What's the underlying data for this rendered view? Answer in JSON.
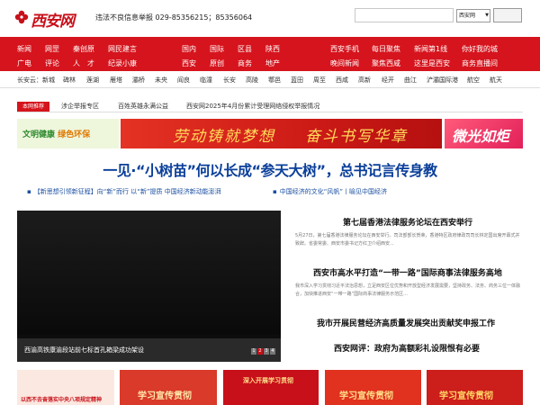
{
  "header": {
    "logo_text": "西安网",
    "report_text": "违法不良信息举报 029-85356215；85356064",
    "site_select": "西安网",
    "search_placeholder": ""
  },
  "nav": {
    "groups": [
      {
        "row1": [
          "新闻",
          "网罡",
          "秦创原",
          "网民建言"
        ],
        "row2": [
          "广电",
          "评论",
          "人　才",
          "纪录小康"
        ]
      },
      {
        "row1": [
          "国内",
          "国际",
          "区县",
          "陕西"
        ],
        "row2": [
          "西安",
          "原创",
          "商务",
          "地产"
        ]
      },
      {
        "row1": [
          "西安手机",
          "每日聚焦",
          "新闻第1线",
          "你好我的城"
        ],
        "row2": [
          "晚间新闻",
          "聚焦西咸",
          "这里是西安",
          "商务直播间"
        ]
      }
    ]
  },
  "subnav": {
    "items": [
      "长安云：新城",
      "碑林",
      "莲湖",
      "雁塔",
      "灞桥",
      "未央",
      "阎良",
      "临潼",
      "长安",
      "高陵",
      "鄠邑",
      "蓝田",
      "周至",
      "西咸",
      "高新",
      "经开",
      "曲江",
      "浐灞国际港",
      "航空",
      "航天"
    ]
  },
  "notice": {
    "tag": "本网推荐",
    "items": [
      "涉企举报专区",
      "百姓英雄永满公益",
      "西安网2025年4月份累计受理网络侵权举报情况"
    ]
  },
  "banners": {
    "left_a": "文明健康",
    "left_b": "绿色环保",
    "center_a": "劳动铸就梦想",
    "center_b": "奋斗书写华章",
    "right": "微光如炬"
  },
  "headline": "一见·“小树苗”何以长成“参天大树”，总书记言传身教",
  "links": [
    "【新思想引领新征程】向“新”而行 以“新”提质 中国经济新动能澎湃",
    "中国经济的文化“风帆”丨喻见中国经济"
  ],
  "slideshow": {
    "caption": "西渝高铁康渝段站前七标首孔箱梁成功架设",
    "pages": [
      "1",
      "2",
      "3",
      "4"
    ],
    "active_page": 2
  },
  "news": [
    {
      "title": "第七届香港法律服务论坛在西安举行",
      "summary": "5月27日，第七届香港法律服务论坛在西安举行。司法部部长贺荣，香港特区政府律政司司长林定国出席开幕式并致辞。省委常委、西安市委书记方红卫介绍西安..."
    },
    {
      "title": "西安市高水平打造“一带一路”国际商事法律服务高地",
      "summary": "我市深入学习贯彻习近平法治思想，立足西安区位优势和开放型经济发展需要，坚持政务、法务、商务三位一体融合，加快推进西安“一带一路”国际商事法律服务示范区..."
    },
    {
      "title": "我市开展民营经济高质量发展突出贡献奖申报工作",
      "summary": ""
    },
    {
      "title": "西安网评：政府为高额彩礼设限恨有必要",
      "summary": ""
    }
  ],
  "thumbs": [
    {
      "text": "以西不去奋落实中央八项规定精神",
      "bg": "#fbe8e0",
      "fg": "#c8101a"
    },
    {
      "text": "学习宣传贯彻",
      "bg": "#d93a2a",
      "fg": "#ffe7a8"
    },
    {
      "text": "深入开展学习贯彻",
      "bg": "#c8101a",
      "fg": "#ffe08a"
    },
    {
      "text": "学习宣传贯彻",
      "bg": "#e0321e",
      "fg": "#ffe08a"
    },
    {
      "text": "学习宣传贯彻",
      "bg": "#cc1e1a",
      "fg": "#ffd966"
    }
  ],
  "colors": {
    "brand_red": "#d6141d",
    "headline_blue": "#0b3f9a"
  }
}
